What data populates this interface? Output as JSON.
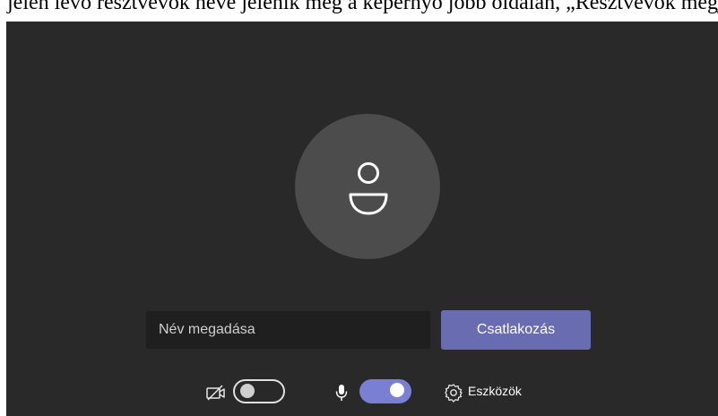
{
  "top_strip": {
    "text": "jelen lévő résztvevők neve jelenik meg a képernyő jobb oldalán, „Résztvevők megj"
  },
  "join_form": {
    "name_placeholder": "Név megadása",
    "join_label": "Csatlakozás"
  },
  "controls": {
    "camera": {
      "icon": "camera-off-icon",
      "enabled": false
    },
    "microphone": {
      "icon": "microphone-icon",
      "enabled": true
    },
    "devices": {
      "icon": "gear-icon",
      "label": "Eszközök"
    }
  },
  "colors": {
    "background": "#292929",
    "avatar_circle": "#4c4c4c",
    "accent": "#6a6cb1",
    "toggle_on": "#7b7fd4",
    "input_bg": "#1f1f1f"
  }
}
